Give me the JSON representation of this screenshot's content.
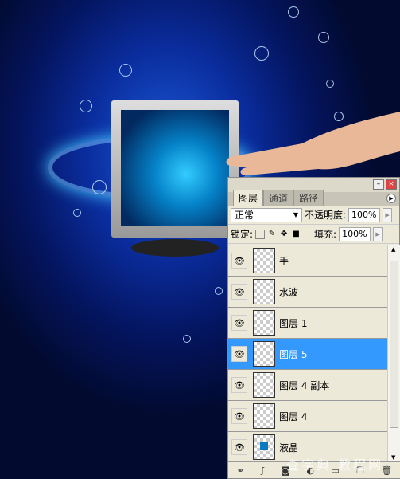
{
  "panel": {
    "tabs": [
      {
        "label": "图层",
        "active": true
      },
      {
        "label": "通道",
        "active": false
      },
      {
        "label": "路径",
        "active": false
      }
    ],
    "blend_mode": "正常",
    "opacity_label": "不透明度:",
    "opacity": "100%",
    "lock_label": "锁定:",
    "fill_label": "填充:",
    "fill": "100%",
    "layers": [
      {
        "name": "手",
        "visible": true,
        "selected": false
      },
      {
        "name": "水波",
        "visible": true,
        "selected": false
      },
      {
        "name": "图层 1",
        "visible": true,
        "selected": false
      },
      {
        "name": "图层 5",
        "visible": true,
        "selected": true
      },
      {
        "name": "图层 4 副本",
        "visible": true,
        "selected": false
      },
      {
        "name": "图层 4",
        "visible": true,
        "selected": false
      },
      {
        "name": "液晶",
        "visible": true,
        "selected": false
      }
    ],
    "selection_color": "#3399ff"
  },
  "watermark": "查字典 教程网"
}
